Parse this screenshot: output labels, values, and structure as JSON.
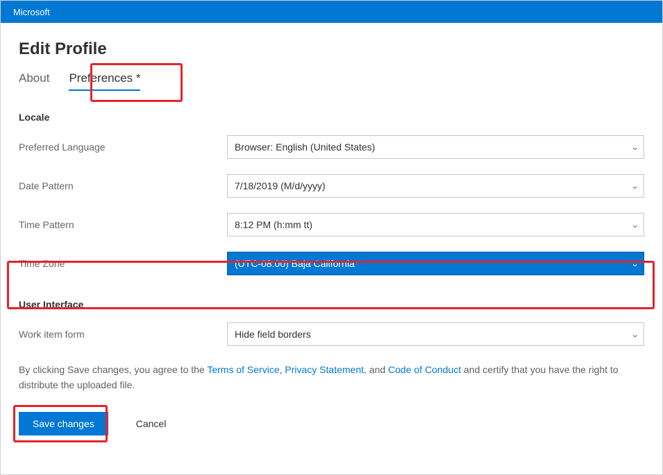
{
  "topbar": {
    "brand": "Microsoft"
  },
  "page": {
    "title": "Edit Profile"
  },
  "tabs": {
    "about": "About",
    "preferences": "Preferences *"
  },
  "sections": {
    "locale_heading": "Locale",
    "ui_heading": "User Interface"
  },
  "fields": {
    "preferred_language": {
      "label": "Preferred Language",
      "value": "Browser: English (United States)"
    },
    "date_pattern": {
      "label": "Date Pattern",
      "value": "7/18/2019 (M/d/yyyy)"
    },
    "time_pattern": {
      "label": "Time Pattern",
      "value": "8:12 PM (h:mm tt)"
    },
    "time_zone": {
      "label": "Time Zone",
      "value": "(UTC-08:00) Baja California"
    },
    "work_item_form": {
      "label": "Work item form",
      "value": "Hide field borders"
    }
  },
  "agree": {
    "prefix": "By clicking Save changes, you agree to the ",
    "terms": "Terms of Service",
    "comma1": ", ",
    "privacy": "Privacy Statement",
    "comma2": ", and ",
    "conduct": "Code of Conduct",
    "suffix": " and certify that you have the right to distribute the uploaded file."
  },
  "buttons": {
    "save": "Save changes",
    "cancel": "Cancel"
  }
}
